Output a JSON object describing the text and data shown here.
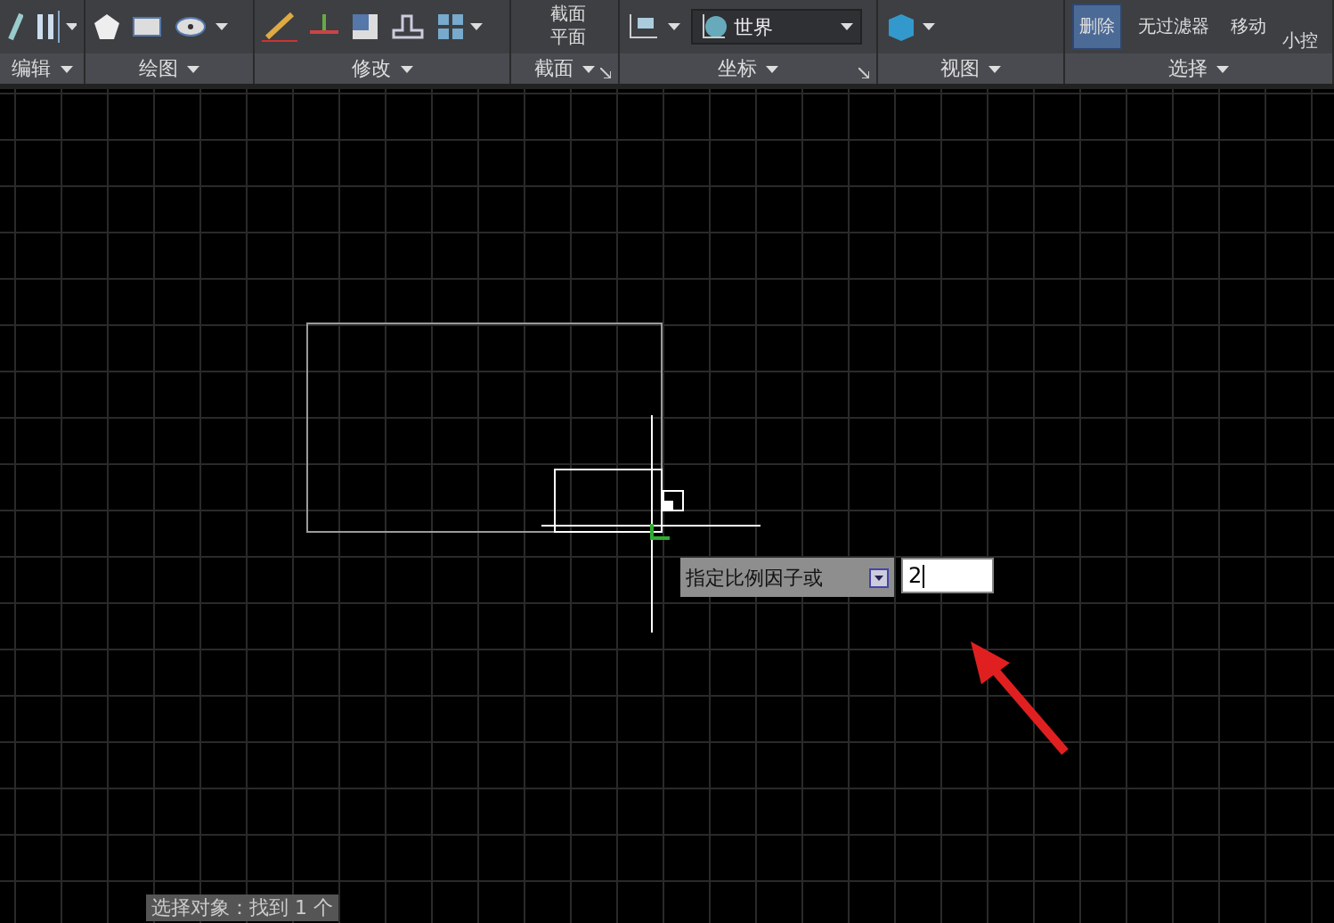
{
  "ribbon": {
    "panels": [
      {
        "kind": "edit",
        "title": "编辑"
      },
      {
        "kind": "draw",
        "title": "绘图"
      },
      {
        "kind": "modify",
        "title": "修改"
      },
      {
        "kind": "section",
        "title": "截面",
        "labels": [
          "截面",
          "平面"
        ]
      },
      {
        "kind": "coordinates",
        "title": "坐标",
        "ucs_dropdown": {
          "value": "世界"
        }
      },
      {
        "kind": "view",
        "title": "视图"
      },
      {
        "kind": "selection",
        "title": "选择",
        "buttons": [
          {
            "label": "删除",
            "highlighted": true
          },
          {
            "label": "无过滤器",
            "highlighted": false
          },
          {
            "label": "移动",
            "highlighted": false
          }
        ],
        "side_label": "小控"
      }
    ]
  },
  "canvas": {
    "prompt": {
      "label": "指定比例因子或",
      "value": "2"
    },
    "command_line": "选择对象：找到 1 个"
  }
}
